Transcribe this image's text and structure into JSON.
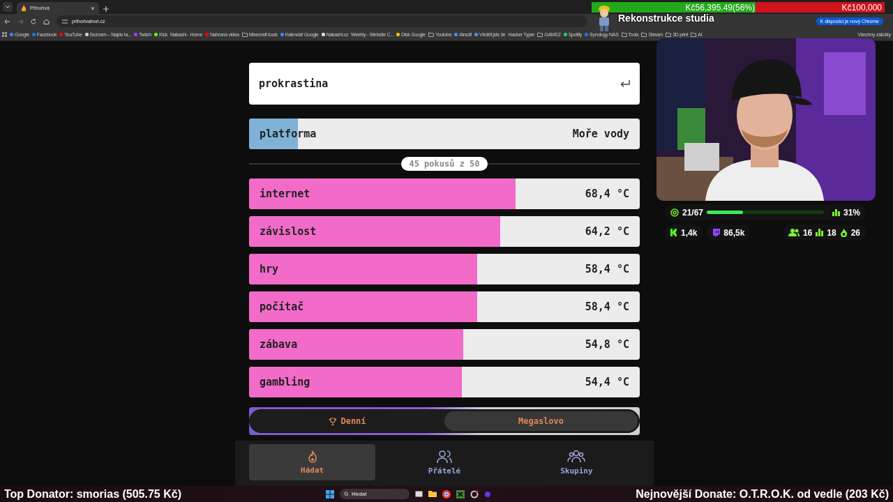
{
  "browser": {
    "tab": {
      "title": "Přihořívá"
    },
    "address": "prihorivahori.cz",
    "update_button": "K dispozici je nový Chrome",
    "bookmarks": [
      {
        "label": "Google",
        "kind": "site",
        "color": "#4285f4"
      },
      {
        "label": "Facebook",
        "kind": "site",
        "color": "#1877f2"
      },
      {
        "label": "YouTube",
        "kind": "site",
        "color": "#ff0000"
      },
      {
        "label": "Seznam – Najdu ta...",
        "kind": "site",
        "color": "#d0d0d0"
      },
      {
        "label": "Twitch",
        "kind": "site",
        "color": "#9146ff"
      },
      {
        "label": "Kick",
        "kind": "site",
        "color": "#53fc18"
      },
      {
        "label": "Nakashi - Home",
        "kind": "plain"
      },
      {
        "label": "Nahraná videa",
        "kind": "site",
        "color": "#ff0000"
      },
      {
        "label": "Minecraft tools",
        "kind": "folder"
      },
      {
        "label": "Kalendář Google",
        "kind": "site",
        "color": "#4285f4"
      },
      {
        "label": "Nakashi.cz",
        "kind": "site",
        "color": "#e0e0e0"
      },
      {
        "label": "Weebly - Website C...",
        "kind": "plain"
      },
      {
        "label": "Disk Google",
        "kind": "site",
        "color": "#fbbc04"
      },
      {
        "label": "Youtube",
        "kind": "folder"
      },
      {
        "label": "Airsoft",
        "kind": "site",
        "color": "#4c8bf5"
      },
      {
        "label": "Věděli jste že",
        "kind": "site",
        "color": "#4c8bf5"
      },
      {
        "label": "Hacker Typer",
        "kind": "plain"
      },
      {
        "label": "GAMEZ",
        "kind": "folder"
      },
      {
        "label": "Spotify",
        "kind": "site",
        "color": "#1ed760"
      },
      {
        "label": "Synology NAS",
        "kind": "site",
        "color": "#2f6fd6"
      },
      {
        "label": "Tools",
        "kind": "folder"
      },
      {
        "label": "Stream",
        "kind": "folder"
      },
      {
        "label": "3D print",
        "kind": "folder"
      },
      {
        "label": "AI",
        "kind": "folder"
      }
    ],
    "all_bookmarks": "Všechny záložky"
  },
  "game": {
    "input": {
      "value": "prokrastina"
    },
    "hint": {
      "word": "platforma",
      "level": 0.125,
      "temperature": "Moře vody"
    },
    "attempts": "45 pokusů z 50",
    "guesses": [
      {
        "word": "internet",
        "level": 0.683,
        "temperature": "68,4 °C"
      },
      {
        "word": "závislost",
        "level": 0.642,
        "temperature": "64,2 °C"
      },
      {
        "word": "hry",
        "level": 0.584,
        "temperature": "58,4 °C"
      },
      {
        "word": "počítač",
        "level": 0.584,
        "temperature": "58,4 °C"
      },
      {
        "word": "zábava",
        "level": 0.548,
        "temperature": "54,8 °C"
      },
      {
        "word": "gambling",
        "level": 0.544,
        "temperature": "54,4 °C"
      }
    ],
    "modes": [
      {
        "label": "Denní",
        "selected": false
      },
      {
        "label": "Megaslovo",
        "selected": true
      }
    ],
    "nav": [
      {
        "label": "Hádat",
        "selected": true
      },
      {
        "label": "Přátelé",
        "selected": false
      },
      {
        "label": "Skupiny",
        "selected": false
      }
    ]
  },
  "stream_overlay": {
    "goal": {
      "raised": "Kč56,395.49(56%)",
      "target": "Kč100,000",
      "level": 0.56,
      "title": "Rekonstrukce studia"
    },
    "stats": {
      "progress": "21/67",
      "level": 0.31,
      "percent": "31%",
      "kick": "1,4k",
      "twitch": "86,5k",
      "followers": "16",
      "bars": "18",
      "subs": "26"
    },
    "top_donator": "Top Donator: smorias  (505.75 Kč)",
    "latest_donate": "Nejnovější Donate: O.T.R.O.K. od vedle (203 Kč)"
  },
  "taskbar": {
    "search_placeholder": "Hledat"
  }
}
